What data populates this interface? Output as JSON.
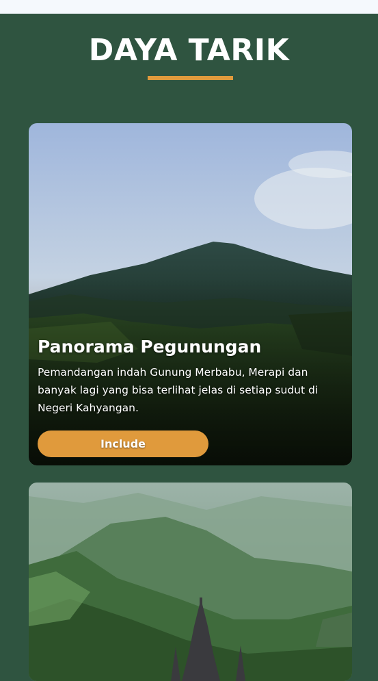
{
  "section": {
    "title": "DAYA TARIK",
    "accent_color": "#e09a3c",
    "background_color": "#2f5440"
  },
  "cards": [
    {
      "title": "Panorama Pegunungan",
      "description": "Pemandangan indah Gunung Merbabu, Merapi dan banyak lagi yang bisa terlihat jelas di setiap sudut di Negeri Kahyangan.",
      "button_label": "Include",
      "image": "mountain-panorama-photo"
    },
    {
      "image": "forested-hills-temple-photo"
    }
  ]
}
